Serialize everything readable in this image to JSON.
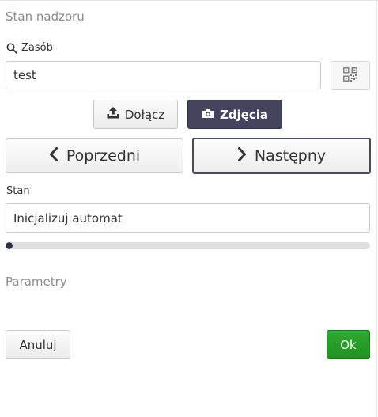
{
  "form": {
    "title": "Stan nadzoru",
    "resource_label": "Zasób",
    "resource_value": "test",
    "state_label": "Stan",
    "state_value": "Inicjalizuj automat",
    "params_label": "Parametry"
  },
  "buttons": {
    "attach": "Dołącz",
    "photos": "Zdjęcia",
    "previous": "Poprzedni",
    "next": "Następny",
    "cancel": "Anuluj",
    "ok": "Ok"
  },
  "progress": {
    "fraction": 0.02
  },
  "icons": {
    "resource": "search-icon",
    "qr": "qr-code-icon",
    "attach": "upload-icon",
    "photos": "camera-icon",
    "previous": "chevron-left-icon",
    "next": "chevron-right-icon"
  },
  "colors": {
    "primary_dark": "#45445e",
    "success": "#2a9f2a",
    "progress": "#2e2e48",
    "muted_text": "#8a8a8a"
  }
}
